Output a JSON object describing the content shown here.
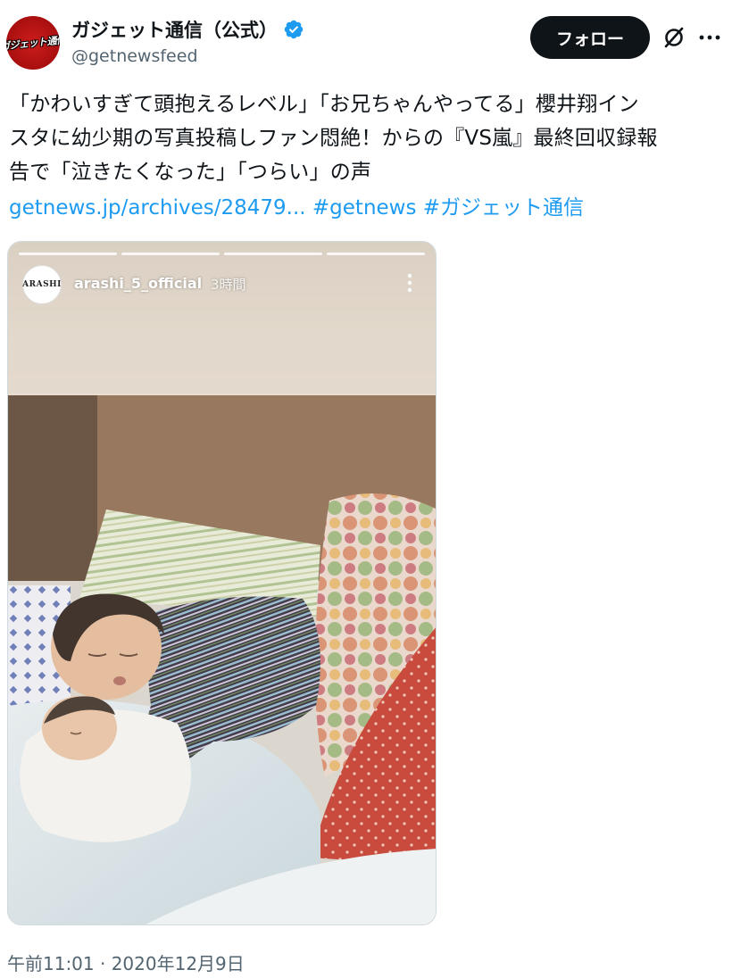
{
  "account": {
    "avatar_text": "ガジェット通信",
    "display_name": "ガジェット通信（公式）",
    "handle": "@getnewsfeed",
    "verified_icon": "verified-badge-icon",
    "brand_color": "#c8161d"
  },
  "actions": {
    "follow_label": "フォロー",
    "grok_icon": "grok-icon",
    "more_icon": "more-dots-icon"
  },
  "post": {
    "lines": [
      "「かわいすぎて頭抱えるレベル」「お兄ちゃんやってる」櫻井翔イン",
      "スタに幼少期の写真投稿しファン悶絶！からの『VS嵐』最終回収録報",
      "告で「泣きたくなった」「つらい」の声"
    ],
    "links": {
      "url": "getnews.jp/archives/28479...",
      "hashtag_1": "#getnews",
      "hashtag_2": "#ガジェット通信"
    },
    "link_color": "#1d9bf0"
  },
  "media": {
    "story": {
      "avatar_text": "ARASHI",
      "username": "arashi_5_official",
      "time": "3時間"
    }
  },
  "meta": {
    "timestamp": "午前11:01 · 2020年12月9日"
  }
}
